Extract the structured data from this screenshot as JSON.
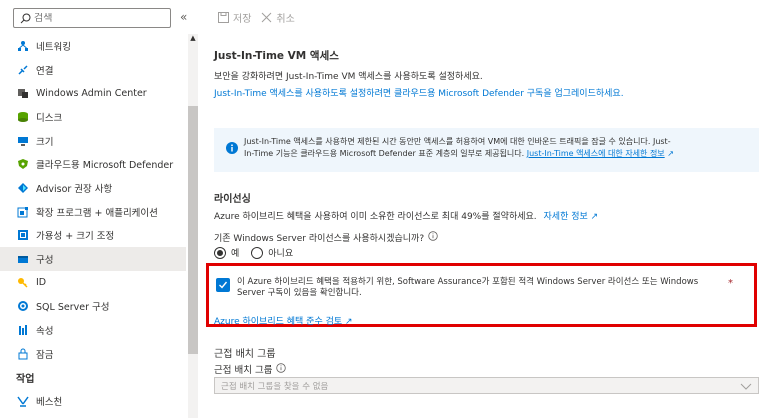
{
  "sidebar": {
    "search_placeholder": "검색",
    "collapse_glyph": "«",
    "items": [
      {
        "label": "네트워킹",
        "icon": "networking-icon",
        "color": "#0078d4"
      },
      {
        "label": "연결",
        "icon": "connect-icon",
        "color": "#0078d4"
      },
      {
        "label": "Windows Admin Center",
        "icon": "windows-admin-center-icon",
        "color": "#605e5c"
      },
      {
        "label": "디스크",
        "icon": "disk-icon",
        "color": "#57a300"
      },
      {
        "label": "크기",
        "icon": "size-icon",
        "color": "#0078d4"
      },
      {
        "label": "클라우드용 Microsoft Defender",
        "icon": "defender-shield-icon",
        "color": "#57a300"
      },
      {
        "label": "Advisor 권장 사항",
        "icon": "advisor-icon",
        "color": "#0078d4"
      },
      {
        "label": "확장 프로그램 + 애플리케이션",
        "icon": "extensions-icon",
        "color": "#0078d4"
      },
      {
        "label": "가용성 + 크기 조정",
        "icon": "availability-icon",
        "color": "#0078d4"
      },
      {
        "label": "구성",
        "icon": "configuration-icon",
        "color": "#0078d4",
        "active": true
      },
      {
        "label": "ID",
        "icon": "identity-key-icon",
        "color": "#ffb900"
      },
      {
        "label": "SQL Server 구성",
        "icon": "sql-server-icon",
        "color": "#0078d4"
      },
      {
        "label": "속성",
        "icon": "properties-icon",
        "color": "#0078d4"
      },
      {
        "label": "잠금",
        "icon": "lock-icon",
        "color": "#0078d4"
      }
    ],
    "section_title": "작업",
    "section_items": [
      {
        "label": "베스천",
        "icon": "bastion-icon",
        "color": "#0078d4"
      }
    ]
  },
  "toolbar": {
    "save_label": "저장",
    "cancel_label": "취소"
  },
  "jit": {
    "title": "Just-In-Time VM 액세스",
    "description": "보안을 강화하려면 Just-In-Time VM 액세스를 사용하도록 설정하세요.",
    "upgrade_link": "Just-In-Time 액세스를 사용하도록 설정하려면 클라우드용 Microsoft Defender 구독을 업그레이드하세요.",
    "info_line1": "Just-In-Time 액세스를 사용하면 제한된 시간 동안만 액세스를 허용하여 VM에 대한 인바운드 트래픽을 잠글 수 있습니다. Just-",
    "info_line2": "In-Time 기능은 클라우드용 Microsoft Defender 표준 계층의 일부로 제공됩니다.",
    "info_link": "Just-In-Time 액세스에 대한 자세한 정보"
  },
  "licensing": {
    "title": "라이선싱",
    "description": "Azure 하이브리드 혜택을 사용하여 이미 소유한 라이선스로 최대 49%를 절약하세요.",
    "learn_more": "자세한 정보",
    "question": "기존 Windows Server 라이선스를 사용하시겠습니까?",
    "yes_label": "예",
    "no_label": "아니요",
    "selected": "예",
    "confirm_text": "이 Azure 하이브리드 혜택을 적용하기 위한, Software Assurance가 포함된 적격 Windows Server 라이선스 또는 Windows Server 구독이 있음을 확인합니다.",
    "confirm_checked": true,
    "required_mark": "*",
    "compliance_link": "Azure 하이브리드 혜택 준수 검토"
  },
  "proximity": {
    "title": "근접 배치 그룹",
    "label": "근접 배치 그룹",
    "placeholder": "근접 배치 그룹을 찾을 수 없음"
  },
  "colors": {
    "accent": "#0078d4",
    "highlight_border": "#e00000",
    "info_background": "#eff6fc"
  }
}
